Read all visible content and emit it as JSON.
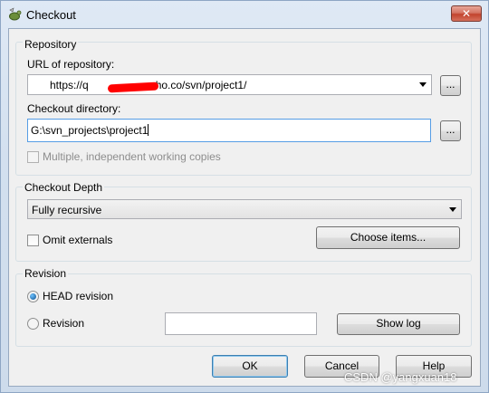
{
  "window": {
    "title": "Checkout",
    "close_label": "✕"
  },
  "repository": {
    "group_label": "Repository",
    "url_label": "URL of repository:",
    "url_value": "https://q",
    "url_value_tail": "ho.co/svn/project1/",
    "url_browse": "...",
    "dir_label": "Checkout directory:",
    "dir_value": "G:\\svn_projects\\project1",
    "dir_browse": "...",
    "multiple_label": "Multiple, independent working copies",
    "multiple_checked": false
  },
  "depth": {
    "group_label": "Checkout Depth",
    "selected": "Fully recursive",
    "omit_label": "Omit externals",
    "omit_checked": false,
    "choose_items": "Choose items..."
  },
  "revision": {
    "group_label": "Revision",
    "head_label": "HEAD revision",
    "head_selected": true,
    "rev_label": "Revision",
    "rev_value": "",
    "show_log": "Show log"
  },
  "buttons": {
    "ok": "OK",
    "cancel": "Cancel",
    "help": "Help"
  },
  "watermark": "CSDN @yangxuan18",
  "colors": {
    "redaction": "#ff0000",
    "default_button_border": "#3c7fb1"
  }
}
